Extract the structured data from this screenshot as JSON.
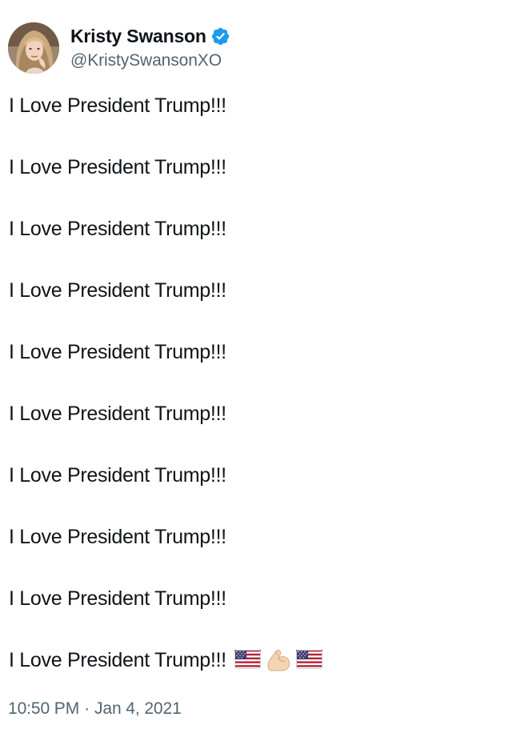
{
  "user": {
    "display_name": "Kristy Swanson",
    "handle": "@KristySwansonXO",
    "verified": true,
    "verified_color": "#1d9bf0",
    "avatar_icon": "profile-photo"
  },
  "tweet": {
    "lines": [
      "I Love President Trump!!!",
      "I Love President Trump!!!",
      "I Love President Trump!!!",
      "I Love President Trump!!!",
      "I Love President Trump!!!",
      "I Love President Trump!!!",
      "I Love President Trump!!!",
      "I Love President Trump!!!",
      "I Love President Trump!!!",
      "I Love President Trump!!!"
    ],
    "final_line_emojis": [
      "us-flag-icon",
      "flexed-biceps-icon",
      "us-flag-icon"
    ],
    "time": "10:50 PM",
    "separator": "·",
    "date": "Jan 4, 2021"
  },
  "colors": {
    "text": "#0f1419",
    "secondary_text": "#536471",
    "background": "#ffffff"
  }
}
